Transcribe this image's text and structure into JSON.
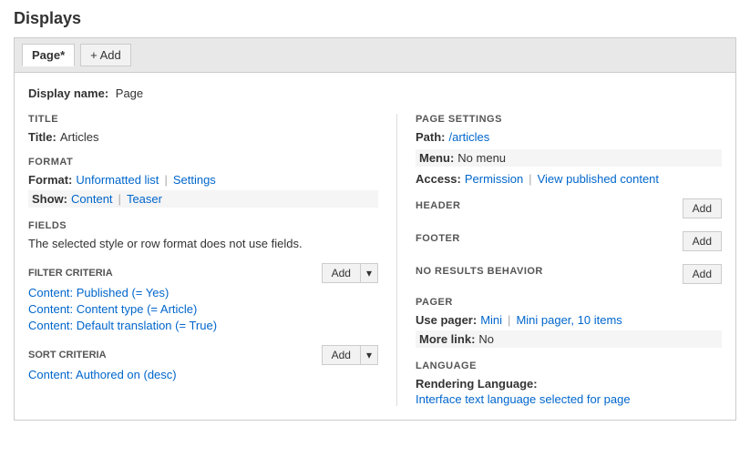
{
  "page": {
    "title": "Displays"
  },
  "tabs": {
    "active_tab": "Page*",
    "add_label": "+ Add"
  },
  "display_name": {
    "label": "Display name:",
    "value": "Page"
  },
  "left_col": {
    "title_section": {
      "heading": "TITLE",
      "label": "Title:",
      "value": "Articles"
    },
    "format_section": {
      "heading": "FORMAT",
      "format_label": "Format:",
      "format_link": "Unformatted list",
      "settings_link": "Settings",
      "show_label": "Show:",
      "show_content_link": "Content",
      "show_teaser_link": "Teaser"
    },
    "fields_section": {
      "heading": "FIELDS",
      "note": "The selected style or row format does not use fields."
    },
    "filter_section": {
      "heading": "FILTER CRITERIA",
      "add_label": "Add",
      "items": [
        "Content: Published (= Yes)",
        "Content: Content type (= Article)",
        "Content: Default translation (= True)"
      ]
    },
    "sort_section": {
      "heading": "SORT CRITERIA",
      "add_label": "Add",
      "items": [
        "Content: Authored on (desc)"
      ]
    }
  },
  "right_col": {
    "page_settings": {
      "heading": "PAGE SETTINGS",
      "path_label": "Path:",
      "path_value": "/articles",
      "menu_label": "Menu:",
      "menu_value": "No menu",
      "access_label": "Access:",
      "access_permission": "Permission",
      "access_view_published": "View published content"
    },
    "header": {
      "heading": "HEADER",
      "add_label": "Add"
    },
    "footer": {
      "heading": "FOOTER",
      "add_label": "Add"
    },
    "no_results": {
      "heading": "NO RESULTS BEHAVIOR",
      "add_label": "Add"
    },
    "pager": {
      "heading": "PAGER",
      "use_pager_label": "Use pager:",
      "use_pager_link1": "Mini",
      "use_pager_link2": "Mini pager, 10 items",
      "more_link_label": "More link:",
      "more_link_value": "No"
    },
    "language": {
      "heading": "LANGUAGE",
      "rendering_label": "Rendering Language:",
      "rendering_value": "Interface text language selected for page"
    }
  },
  "icons": {
    "plus": "+",
    "dropdown": "▾"
  }
}
